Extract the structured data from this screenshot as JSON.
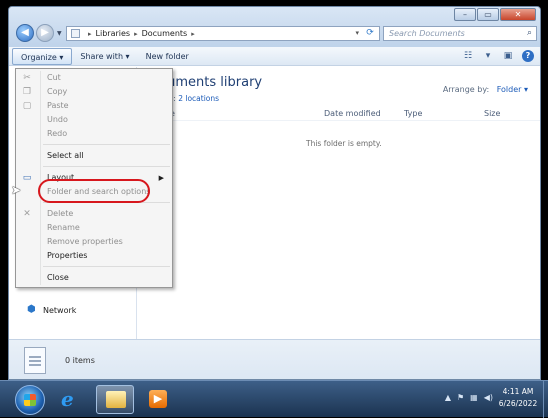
{
  "address": {
    "crumbs": [
      "Libraries",
      "Documents"
    ],
    "search_placeholder": "Search Documents"
  },
  "toolbar": {
    "organize": "Organize ▾",
    "share_with": "Share with ▾",
    "new_folder": "New folder"
  },
  "menu": {
    "items": [
      {
        "label": "Cut",
        "disabled": true
      },
      {
        "label": "Copy",
        "disabled": true
      },
      {
        "label": "Paste",
        "disabled": true
      },
      {
        "label": "Undo",
        "disabled": true
      },
      {
        "label": "Redo",
        "disabled": true
      },
      {
        "label": "Select all",
        "disabled": false
      },
      {
        "label": "Layout",
        "disabled": false
      },
      {
        "label": "Folder and search options",
        "disabled": true
      },
      {
        "label": "Delete",
        "disabled": true
      },
      {
        "label": "Rename",
        "disabled": true
      },
      {
        "label": "Remove properties",
        "disabled": true
      },
      {
        "label": "Properties",
        "disabled": false
      },
      {
        "label": "Close",
        "disabled": false
      }
    ]
  },
  "library": {
    "title": "cuments library",
    "subtitle_prefix": "des:",
    "locations_link": "2 locations",
    "arrange_label": "Arrange by:",
    "arrange_value": "Folder ▾",
    "columns": [
      "e",
      "Date modified",
      "Type",
      "Size"
    ],
    "empty_text": "This folder is empty."
  },
  "navpane": {
    "network": "Network"
  },
  "status": {
    "item_count": "0 items"
  },
  "taskbar": {
    "time": "4:11 AM",
    "date": "6/26/2022"
  },
  "colors": {
    "highlight_circle": "#d7171d",
    "link": "#1c5bb8",
    "title": "#1f3f73"
  }
}
